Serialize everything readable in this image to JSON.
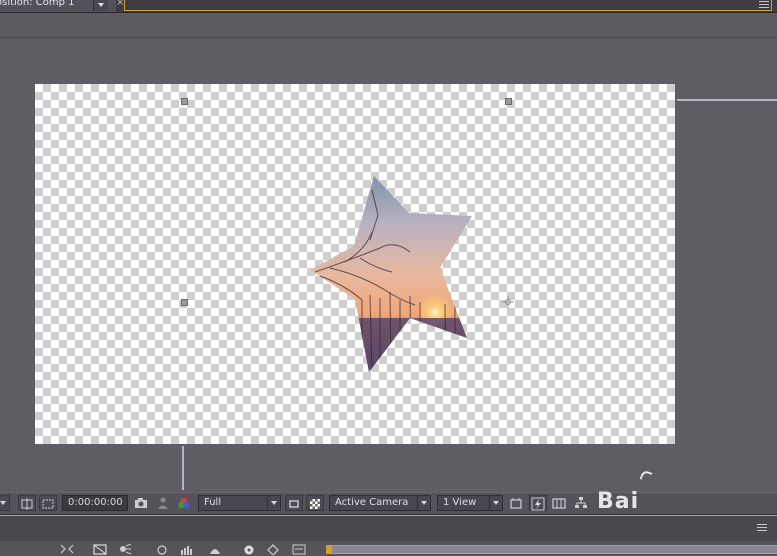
{
  "panel": {
    "tab_title": "osition: Comp 1",
    "tab_close": "×"
  },
  "viewer": {
    "timecode": "0:00:00:00",
    "resolution": "Full",
    "camera": "Active Camera",
    "views": "1 View"
  },
  "watermark": {
    "text": "Bai"
  },
  "colors": {
    "panel_bg": "#605c64",
    "active_panel_border": "#c9a33a",
    "guide_line": "#b8b4c4"
  },
  "icons": {
    "tab_menu": "chevron-down-icon",
    "panel_menu": "panel-menu-icon",
    "snapshot": "camera-icon",
    "show_snapshot": "person-icon",
    "channels": "rgb-channels-icon",
    "region_of_interest": "region-icon",
    "transparency_grid": "checkerboard-icon",
    "fast_previews": "fast-preview-icon",
    "flowchart": "flowchart-icon"
  }
}
